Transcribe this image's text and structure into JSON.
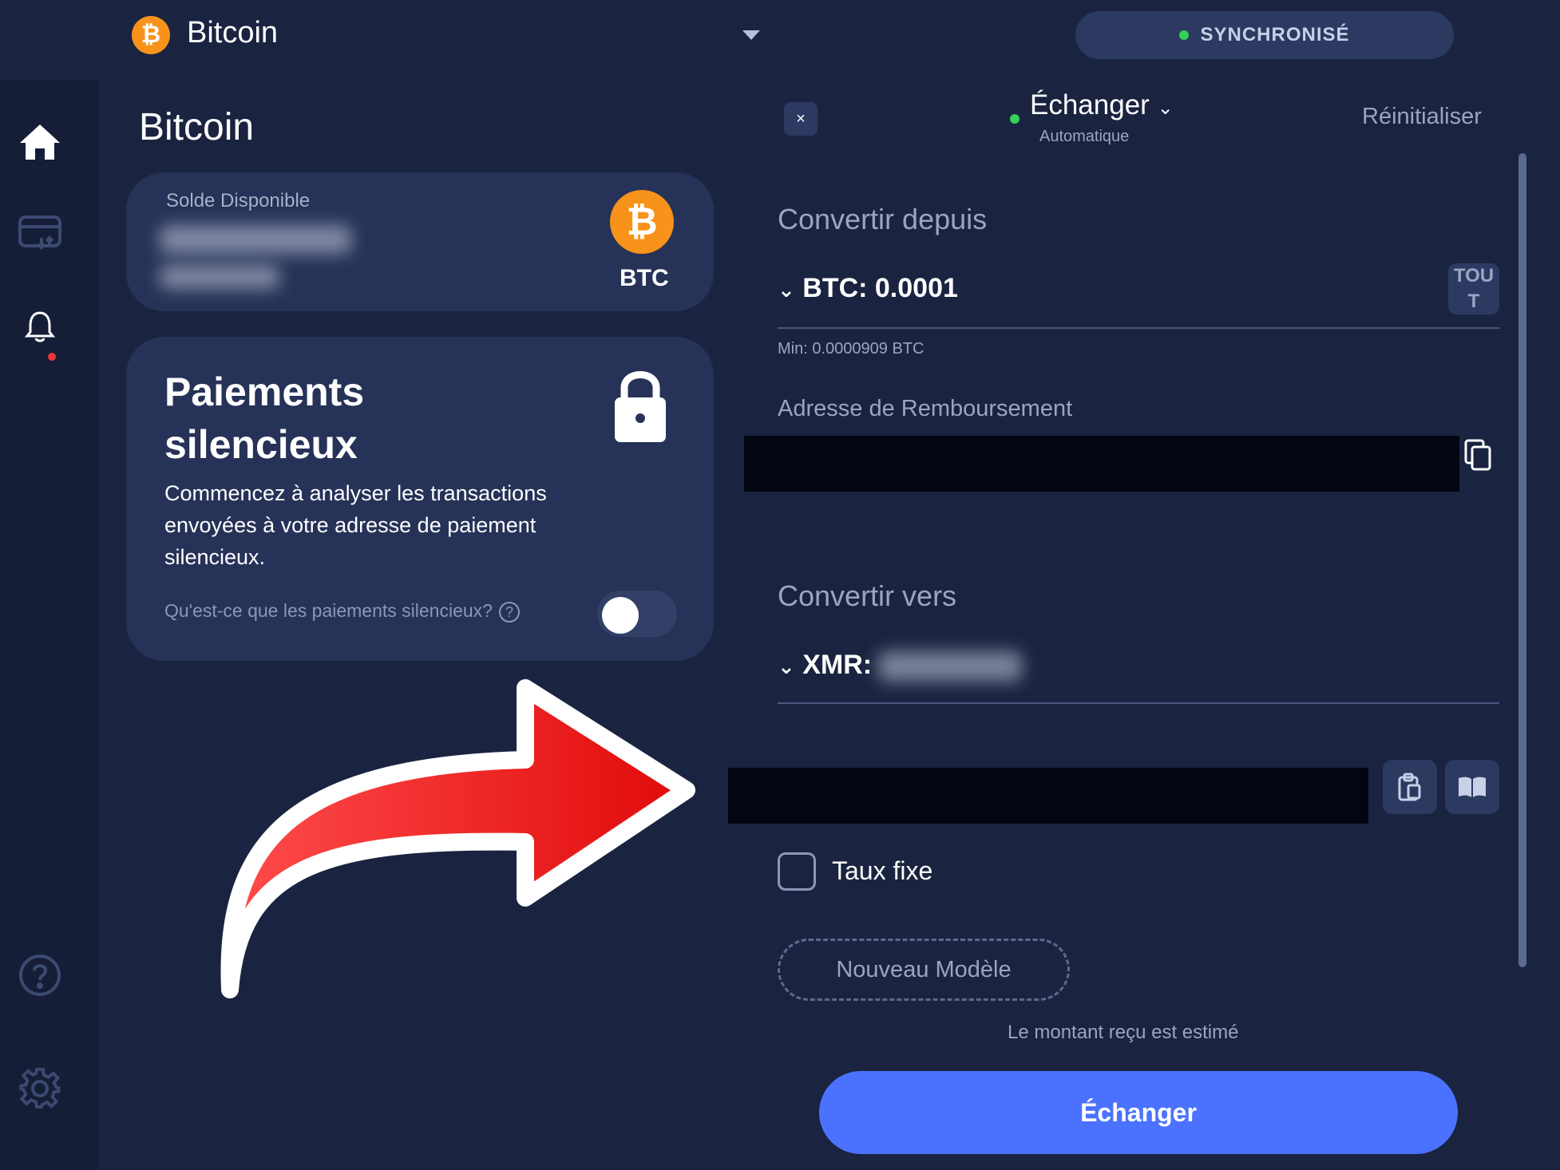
{
  "header": {
    "coin_symbol": "₿",
    "coin_name": "Bitcoin",
    "status": "SYNCHRONISÉ"
  },
  "sidebar": {
    "items": [
      "home-icon",
      "card-swap-icon",
      "bell-icon",
      "help-icon",
      "gear-icon"
    ]
  },
  "page": {
    "title": "Bitcoin"
  },
  "balance": {
    "label": "Solde Disponible",
    "ticker": "BTC",
    "icon_symbol": "₿"
  },
  "silent_payments": {
    "title": "Paiements silencieux",
    "description": "Commencez à analyser les transactions envoyées à votre adresse de paiement silencieux.",
    "link": "Qu'est-ce que les paiements silencieux?",
    "help_symbol": "?",
    "enabled": false
  },
  "exchange": {
    "close_symbol": "×",
    "mode_title": "Échanger",
    "mode_sub": "Automatique",
    "reset": "Réinitialiser",
    "from": {
      "heading": "Convertir depuis",
      "amount": "BTC: 0.0001",
      "all_button": "TOU T",
      "min": "Min: 0.0000909 BTC",
      "refund_label": "Adresse de Remboursement"
    },
    "to": {
      "heading": "Convertir vers",
      "amount_prefix": "XMR:"
    },
    "fixed_rate_label": "Taux fixe",
    "fixed_rate_checked": false,
    "new_template": "Nouveau Modèle",
    "estimate_note": "Le montant reçu est estimé",
    "submit": "Échanger"
  },
  "colors": {
    "background": "#1a2440",
    "card": "#263257",
    "accent": "#4a72ff",
    "bitcoin": "#f7931a",
    "status_green": "#35d05a"
  }
}
